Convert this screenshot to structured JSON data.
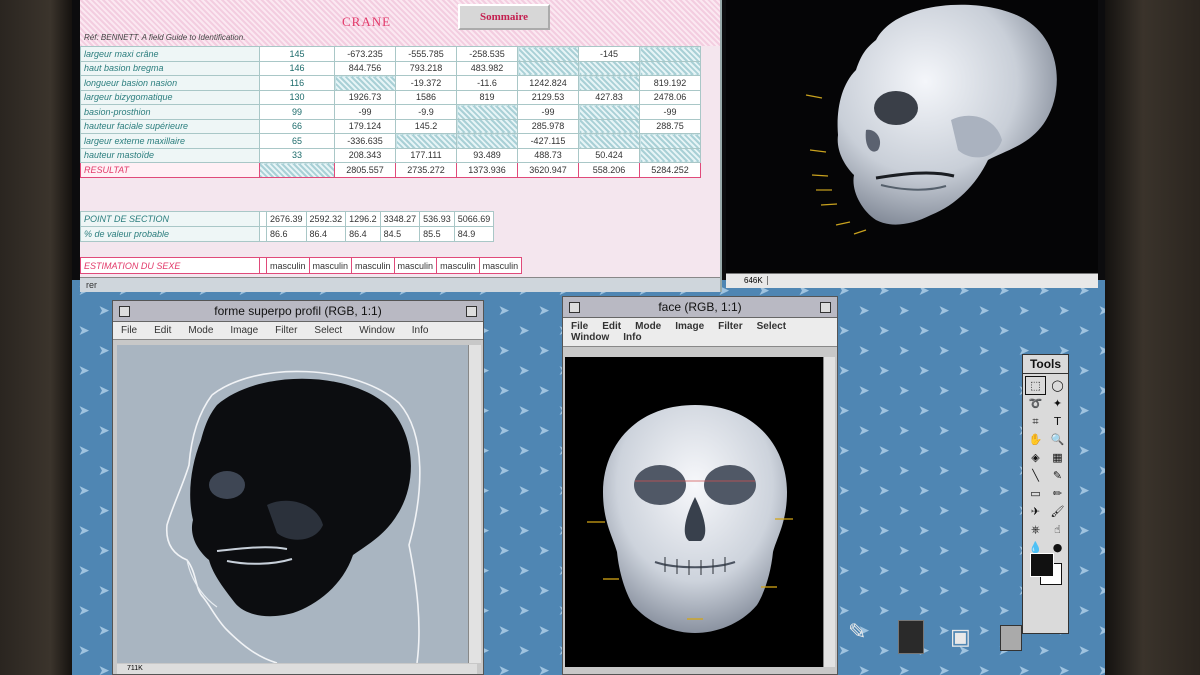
{
  "spreadsheet": {
    "title": "CRANE",
    "sommaire_button": "Sommaire",
    "reference": "Réf: BENNETT. A field Guide to Identification.",
    "rows": [
      {
        "label": "largeur maxi crâne",
        "val": "145",
        "cells": [
          "-673.235",
          "-555.785",
          "-258.535",
          "",
          "-145",
          ""
        ]
      },
      {
        "label": "haut basion bregma",
        "val": "146",
        "cells": [
          "844.756",
          "793.218",
          "483.982",
          "",
          "",
          ""
        ]
      },
      {
        "label": "longueur basion nasion",
        "val": "116",
        "cells": [
          "",
          "-19.372",
          "-11.6",
          "1242.824",
          "",
          "819.192"
        ]
      },
      {
        "label": "largeur bizygomatique",
        "val": "130",
        "cells": [
          "1926.73",
          "1586",
          "819",
          "2129.53",
          "427.83",
          "2478.06"
        ]
      },
      {
        "label": "basion-prosthion",
        "val": "99",
        "cells": [
          "-99",
          "-9.9",
          "",
          "-99",
          "",
          "-99"
        ]
      },
      {
        "label": "hauteur faciale supérieure",
        "val": "66",
        "cells": [
          "179.124",
          "145.2",
          "",
          "285.978",
          "",
          "288.75"
        ]
      },
      {
        "label": "largeur externe maxillaire",
        "val": "65",
        "cells": [
          "-336.635",
          "",
          "",
          "-427.115",
          "",
          ""
        ]
      },
      {
        "label": "hauteur mastoïde",
        "val": "33",
        "cells": [
          "208.343",
          "177.111",
          "93.489",
          "488.73",
          "50.424",
          ""
        ]
      }
    ],
    "result": {
      "label": "RESULTAT",
      "cells": [
        "2805.557",
        "2735.272",
        "1373.936",
        "3620.947",
        "558.206",
        "5284.252"
      ]
    },
    "section": {
      "label": "POINT DE SECTION",
      "cells": [
        "2676.39",
        "2592.32",
        "1296.2",
        "3348.27",
        "536.93",
        "5066.69"
      ]
    },
    "probable": {
      "label": "% de valeur probable",
      "cells": [
        "86.6",
        "86.4",
        "86.4",
        "84.5",
        "85.5",
        "84.9"
      ]
    },
    "sex": {
      "label": "ESTIMATION DU SEXE",
      "cells": [
        "masculin",
        "masculin",
        "masculin",
        "masculin",
        "masculin",
        "masculin"
      ]
    },
    "status": "rer"
  },
  "skull_window": {
    "status_size": "646K"
  },
  "profile_window": {
    "title": "forme superpo profil  (RGB, 1:1)",
    "menu": [
      "File",
      "Edit",
      "Mode",
      "Image",
      "Filter",
      "Select",
      "Window",
      "Info"
    ],
    "foot_size": "711K"
  },
  "face_window": {
    "title": "face  (RGB, 1:1)",
    "menu": [
      "File",
      "Edit",
      "Mode",
      "Image",
      "Filter",
      "Select",
      "Window",
      "Info"
    ]
  },
  "tools_palette": {
    "title": "Tools",
    "tools": [
      "marquee-rect",
      "marquee-ellipse",
      "lasso",
      "magic-wand",
      "crop",
      "type",
      "hand",
      "zoom",
      "bucket",
      "gradient",
      "line",
      "eyedropper",
      "eraser",
      "pencil",
      "airbrush",
      "paintbrush",
      "stamp",
      "smudge",
      "blur",
      "dodge"
    ],
    "glyphs": [
      "⬚",
      "◯",
      "➰",
      "✦",
      "⌗",
      "T",
      "✋",
      "🔍",
      "◈",
      "▦",
      "╲",
      "✎",
      "▭",
      "✏",
      "✈",
      "🖌",
      "⎈",
      "☝",
      "💧",
      "●"
    ]
  },
  "colors": {
    "desktop": "#4f86b3",
    "sheet_accent": "#e23a6a",
    "sheet_teal": "#2a7d7d"
  }
}
